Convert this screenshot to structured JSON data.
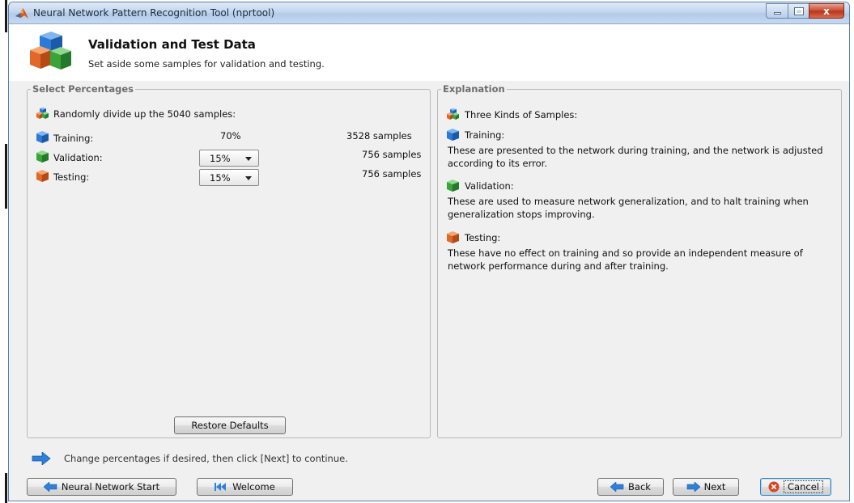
{
  "window": {
    "title": "Neural Network Pattern Recognition Tool (nprtool)",
    "close_glyph": "x"
  },
  "header": {
    "title": "Validation and Test Data",
    "subtitle": "Set aside some samples for validation and testing."
  },
  "select_percentages": {
    "legend": "Select Percentages",
    "intro": "Randomly divide up the 5040 samples:",
    "rows": [
      {
        "label": "Training:",
        "value": "70%",
        "samples": "3528 samples",
        "icon": "blue-cube-icon"
      },
      {
        "label": "Validation:",
        "value": "15%",
        "samples": "756 samples",
        "icon": "green-cube-icon"
      },
      {
        "label": "Testing:",
        "value": "15%",
        "samples": "756 samples",
        "icon": "orange-cube-icon"
      }
    ],
    "restore_defaults_label": "Restore Defaults"
  },
  "explanation": {
    "legend": "Explanation",
    "intro": "Three Kinds of Samples:",
    "sections": [
      {
        "title": "Training:",
        "text": "These are presented to the network during training, and the network is adjusted according to its error."
      },
      {
        "title": "Validation:",
        "text": "These are used to measure network generalization, and to halt training when generalization stops improving."
      },
      {
        "title": "Testing:",
        "text": "These have no effect on training and so provide an independent measure of network performance during and after training."
      }
    ]
  },
  "hint": {
    "text": "Change percentages if desired, then click [Next] to continue."
  },
  "footer": {
    "nn_start_label": "Neural Network Start",
    "welcome_label": "Welcome",
    "back_label": "Back",
    "next_label": "Next",
    "cancel_label": "Cancel"
  },
  "colors": {
    "blue": "#2b7bd6",
    "green": "#3aa33a",
    "orange": "#e2682a",
    "arrow": "#2f80d8"
  }
}
